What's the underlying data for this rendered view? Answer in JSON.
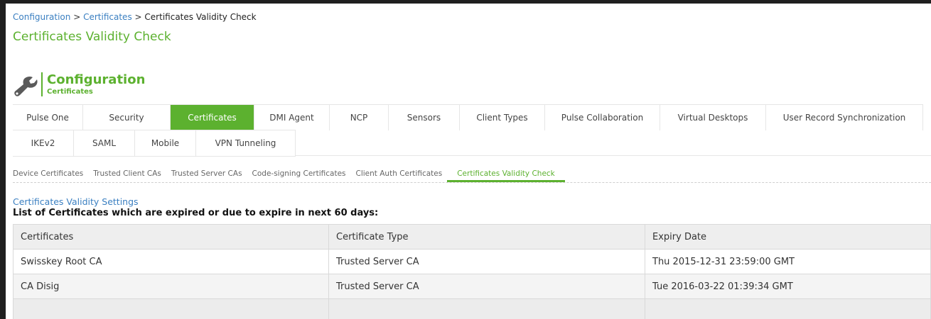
{
  "breadcrumb": {
    "items": [
      "Configuration",
      "Certificates"
    ],
    "current": "Certificates Validity Check",
    "separator": ">"
  },
  "page_title": "Certificates Validity Check",
  "section": {
    "title": "Configuration",
    "subtitle": "Certificates",
    "icon": "wrench-icon"
  },
  "tabs": {
    "row1": [
      "Pulse One",
      "Security",
      "Certificates",
      "DMI Agent",
      "NCP",
      "Sensors",
      "Client Types",
      "Pulse Collaboration",
      "Virtual Desktops",
      "User Record Synchronization"
    ],
    "row2": [
      "IKEv2",
      "SAML",
      "Mobile",
      "VPN Tunneling"
    ],
    "active": "Certificates"
  },
  "subtabs": {
    "items": [
      "Device Certificates",
      "Trusted Client CAs",
      "Trusted Server CAs",
      "Code-signing Certificates",
      "Client Auth Certificates",
      "Certificates Validity Check"
    ],
    "active": "Certificates Validity Check"
  },
  "settings_link": "Certificates Validity Settings",
  "list_heading": "List of Certificates which are expired or due to expire in next 60 days:",
  "table": {
    "columns": [
      "Certificates",
      "Certificate Type",
      "Expiry Date"
    ],
    "rows": [
      [
        "Swisskey Root CA",
        "Trusted Server CA",
        "Thu 2015-12-31 23:59:00 GMT"
      ],
      [
        "CA Disig",
        "Trusted Server CA",
        "Tue 2016-03-22 01:39:34 GMT"
      ],
      [
        "",
        "",
        ""
      ]
    ]
  },
  "colors": {
    "accent": "#5cb12f",
    "link": "#3a7fc1"
  }
}
